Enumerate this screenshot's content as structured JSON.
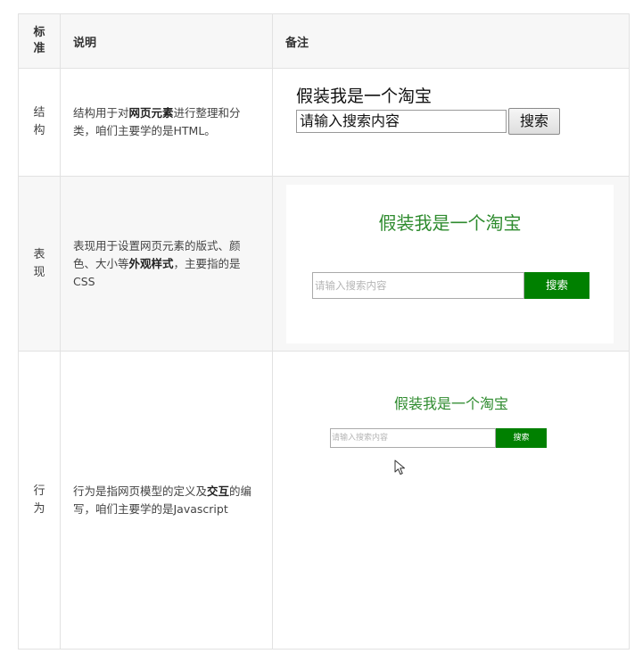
{
  "table": {
    "headers": {
      "standard": "标准",
      "description": "说明",
      "remark": "备注"
    },
    "rows": [
      {
        "standard": "结构",
        "desc_parts": [
          "结构用于对",
          "网页元素",
          "进行整理和分类，咱们主要学的是HTML。"
        ],
        "demo": {
          "title": "假装我是一个淘宝",
          "input_value": "请输入搜索内容",
          "button": "搜索"
        }
      },
      {
        "standard": "表现",
        "desc_parts": [
          "表现用于设置网页元素的版式、颜色、大小等",
          "外观样式",
          "，主要指的是CSS"
        ],
        "demo": {
          "title": "假装我是一个淘宝",
          "placeholder": "请输入搜索内容",
          "button": "搜索"
        }
      },
      {
        "standard": "行为",
        "desc_parts": [
          "行为是指网页模型的定义及",
          "交互",
          "的编写，咱们主要学的是Javascript"
        ],
        "demo": {
          "title": "假装我是一个淘宝",
          "placeholder": "请输入搜索内容",
          "button": "搜索"
        }
      }
    ]
  },
  "colors": {
    "accent_green": "#008000",
    "title_green": "#2e8b2e"
  },
  "icons": {
    "cursor": "mouse-pointer-icon"
  }
}
